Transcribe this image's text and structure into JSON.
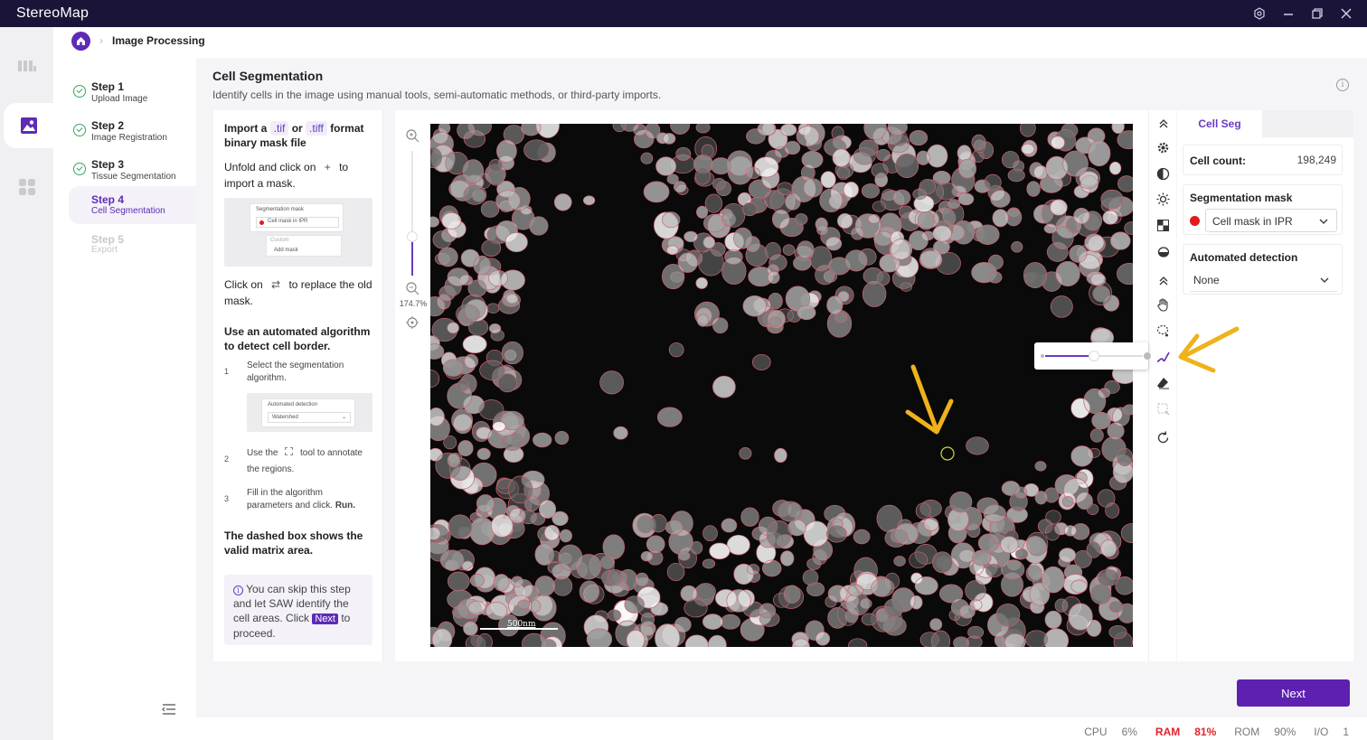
{
  "app": {
    "title": "StereoMap"
  },
  "breadcrumb": {
    "current": "Image Processing"
  },
  "steps": [
    {
      "title": "Step 1",
      "subtitle": "Upload Image",
      "state": "done"
    },
    {
      "title": "Step 2",
      "subtitle": "Image Registration",
      "state": "done"
    },
    {
      "title": "Step 3",
      "subtitle": "Tissue Segmentation",
      "state": "done"
    },
    {
      "title": "Step 4",
      "subtitle": "Cell Segmentation",
      "state": "active"
    },
    {
      "title": "Step 5",
      "subtitle": "Export",
      "state": "disabled"
    }
  ],
  "page": {
    "title": "Cell Segmentation",
    "description": "Identify cells in the image using manual tools, semi-automatic methods, or third-party imports."
  },
  "instructions": {
    "import_a": "Import a",
    "tif": ".tif",
    "or": "or",
    "tiff": ".tiff",
    "format": "format",
    "binary": "binary mask file",
    "unfold_a": "Unfold and click on",
    "unfold_b": "to",
    "unfold_c": "import a mask.",
    "thumb1_title": "Segmentation mask",
    "thumb1_item": "Cell mask in IPR",
    "thumb1_custom": "Custom",
    "thumb1_add": "Add mask",
    "replace_a": "Click on",
    "replace_b": "to replace the",
    "replace_c": "old mask.",
    "algo_heading": "Use an automated algorithm to detect cell border.",
    "s1_num": "1",
    "s1_text": "Select the segmentation algorithm.",
    "thumb2_title": "Automated detection",
    "thumb2_value": "Watershed",
    "s2_num": "2",
    "s2_a": "Use the",
    "s2_b": "tool to annotate",
    "s2_c": "the regions.",
    "s3_num": "3",
    "s3_a": "Fill in the algorithm",
    "s3_b": "parameters and click.",
    "s3_run": "Run.",
    "dashed_note": "The dashed box shows the valid matrix area.",
    "tip_a": "You can skip this step and let SAW identify the cell areas. Click",
    "tip_next": "Next",
    "tip_b": "to proceed."
  },
  "zoom": {
    "level": "174.7%",
    "slider_fraction": 0.33
  },
  "canvas": {
    "scalebar_label": "500nm"
  },
  "tools": [
    "collapse-up-icon",
    "settings-icon",
    "contrast-icon",
    "brightness-icon",
    "grid-icon",
    "drop-icon",
    "collapse-up-icon",
    "hand-icon",
    "lasso-icon",
    "brush-icon",
    "eraser-icon",
    "select-box-icon",
    "refresh-icon"
  ],
  "brush": {
    "size_fraction": 0.5
  },
  "right_panel": {
    "tab": "Cell Seg",
    "cell_count_label": "Cell count:",
    "cell_count_value": "198,249",
    "seg_mask_title": "Segmentation mask",
    "seg_mask_value": "Cell mask in IPR",
    "auto_title": "Automated detection",
    "auto_value": "None"
  },
  "next_button": "Next",
  "status": {
    "cpu_label": "CPU",
    "cpu_value": "6%",
    "ram_label": "RAM",
    "ram_value": "81%",
    "rom_label": "ROM",
    "rom_value": "90%",
    "io_label": "I/O",
    "io_value": "1"
  },
  "colors": {
    "brand": "#5d2bb5",
    "warning": "#e0242c",
    "annotation": "#f0b21c",
    "cell_outline": "#c8646e"
  }
}
